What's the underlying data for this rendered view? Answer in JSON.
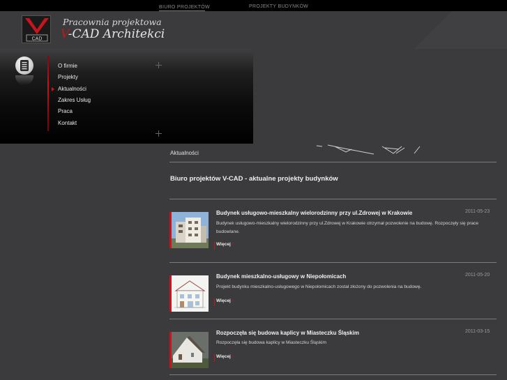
{
  "topnav": {
    "link1": "BIURO PROJEKTÓW",
    "link2": "PROJEKTY BUDYNKÓW"
  },
  "brand": {
    "line1": "Pracownia projektowa",
    "v": "V",
    "rest": "-CAD Architekci",
    "logo_text": "CAD"
  },
  "menu": {
    "items": [
      "O firmie",
      "Projekty",
      "Aktualności",
      "Zakres Usług",
      "Praca",
      "Kontakt"
    ],
    "active": "Aktualności",
    "icon": "document-icon"
  },
  "breadcrumb": "Aktualności",
  "page_title": "Biuro projektów V-CAD - aktualne projekty budynków",
  "news": [
    {
      "title": "Budynek usługowo-mieszkalny wielorodzinny przy ul.Zdrowej w Krakowie",
      "date": "2011-05-23",
      "desc": "Budynek usługowo-mieszkalny wielorodzinny przy ul.Zdrowej w Krakowie otrzymał pozwolenie na budowę. Rozpoczęły się prace budowlane.",
      "more": "Więcej"
    },
    {
      "title": "Budynek mieszkalno-usługowy w Niepołomicach",
      "date": "2011-05-20",
      "desc": "Projekt budynku mieszkalno-usługowego w Niepołomicach został złożony do pozwolenia na budowę.",
      "more": "Więcej"
    },
    {
      "title": "Rozpoczęła się budowa kaplicy w Miasteczku Śląskim",
      "date": "2011-03-15",
      "desc": "Rozpoczęła się budowa kaplicy w Miasteczku Śląskim",
      "more": "Więcej"
    }
  ],
  "colors": {
    "accent": "#c8141c",
    "background": "#3b3b3d",
    "topbar": "#000000"
  }
}
